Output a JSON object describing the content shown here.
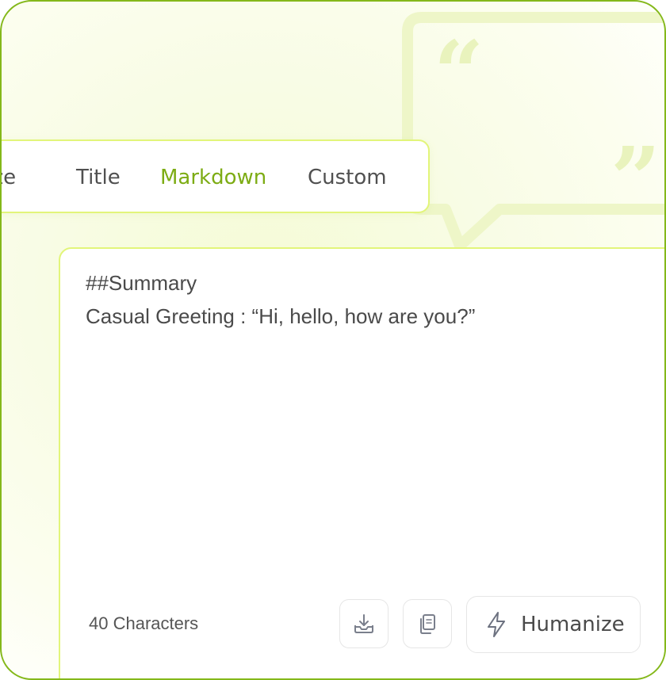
{
  "tabs": [
    {
      "label": "lize",
      "active": false
    },
    {
      "label": "Title",
      "active": false
    },
    {
      "label": "Markdown",
      "active": true
    },
    {
      "label": "Custom",
      "active": false
    }
  ],
  "editor": {
    "lines": [
      "##Summary",
      "Casual Greeting : “Hi, hello, how are you?”"
    ]
  },
  "footer": {
    "char_count": "40 Characters",
    "download_icon": "download-icon",
    "copy_icon": "copy-icon",
    "humanize_icon": "lightning-icon",
    "humanize_label": "Humanize"
  },
  "colors": {
    "accent": "#7dac14",
    "border": "#84b81a",
    "tab_border": "#e2f57a",
    "decor": "#eef7c6"
  }
}
